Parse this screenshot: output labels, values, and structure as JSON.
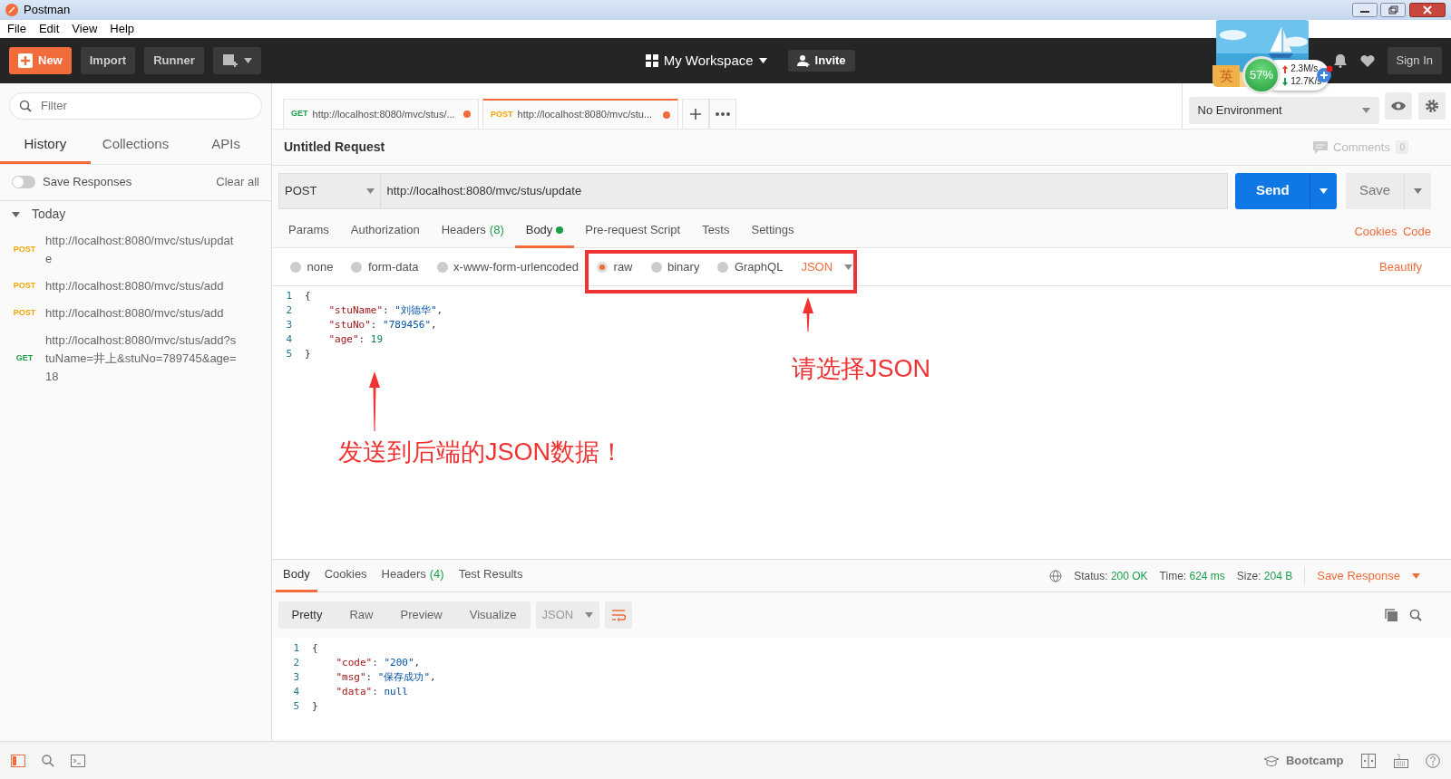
{
  "window": {
    "title": "Postman"
  },
  "menu": [
    "File",
    "Edit",
    "View",
    "Help"
  ],
  "header": {
    "new": "New",
    "buttons": [
      "Import",
      "Runner"
    ],
    "workspace": "My Workspace",
    "invite": "Invite",
    "sign_in": "Sign In"
  },
  "speed_widget": {
    "badge": "英",
    "percent": "57%",
    "upload": "2.3M/s",
    "download": "12.7K/s"
  },
  "sidebar": {
    "filter_placeholder": "Filter",
    "tabs": [
      {
        "label": "History",
        "selected": true
      },
      {
        "label": "Collections",
        "selected": false
      },
      {
        "label": "APIs",
        "selected": false
      }
    ],
    "save_responses": {
      "label": "Save Responses",
      "on": false
    },
    "clear_all": "Clear all",
    "group": {
      "label": "Today",
      "expanded": true,
      "items": [
        {
          "method": "POST",
          "color": "#f4a400",
          "url": "http://localhost:8080/mvc/stus/update"
        },
        {
          "method": "POST",
          "color": "#f4a400",
          "url": "http://localhost:8080/mvc/stus/add"
        },
        {
          "method": "POST",
          "color": "#f4a400",
          "url": "http://localhost:8080/mvc/stus/add"
        },
        {
          "method": "GET",
          "color": "#1c9e4a",
          "url": "http://localhost:8080/mvc/stus/add?stuName=井上&stuNo=789745&age=18"
        }
      ]
    }
  },
  "request_tabs": [
    {
      "method": "GET",
      "color": "#1c9e4a",
      "url": "http://localhost:8080/mvc/stus/...",
      "selected": false,
      "unsaved": true
    },
    {
      "method": "POST",
      "color": "#f4a400",
      "url": "http://localhost:8080/mvc/stu...",
      "selected": true,
      "unsaved": true
    }
  ],
  "environment": "No Environment",
  "request": {
    "title": "Untitled Request",
    "comments": "Comments",
    "comments_count": "0",
    "method": "POST",
    "url": "http://localhost:8080/mvc/stus/update",
    "send": "Send",
    "save": "Save"
  },
  "request_sections": [
    {
      "label": "Params",
      "selected": false
    },
    {
      "label": "Authorization",
      "selected": false
    },
    {
      "label": "Headers",
      "count": "(8)",
      "selected": false
    },
    {
      "label": "Body",
      "selected": true,
      "dot": true
    },
    {
      "label": "Pre-request Script",
      "selected": false
    },
    {
      "label": "Tests",
      "selected": false
    },
    {
      "label": "Settings",
      "selected": false
    }
  ],
  "request_links": [
    "Cookies",
    "Code"
  ],
  "body_types": [
    {
      "label": "none",
      "selected": false
    },
    {
      "label": "form-data",
      "selected": false
    },
    {
      "label": "x-www-form-urlencoded",
      "selected": false
    },
    {
      "label": "raw",
      "selected": true
    },
    {
      "label": "binary",
      "selected": false
    },
    {
      "label": "GraphQL",
      "selected": false
    }
  ],
  "body_format": "JSON",
  "beautify": "Beautify",
  "request_body": [
    {
      "number": "1",
      "tokens": [
        {
          "kind": "punct",
          "text": "{"
        }
      ]
    },
    {
      "number": "2",
      "tokens": [
        {
          "kind": "key",
          "text": "\"stuName\""
        },
        {
          "kind": "punct",
          "text": ": "
        },
        {
          "kind": "string",
          "text": "\"刘德华\""
        },
        {
          "kind": "punct",
          "text": ","
        }
      ]
    },
    {
      "number": "3",
      "tokens": [
        {
          "kind": "key",
          "text": "\"stuNo\""
        },
        {
          "kind": "punct",
          "text": ": "
        },
        {
          "kind": "string",
          "text": "\"789456\""
        },
        {
          "kind": "punct",
          "text": ","
        }
      ]
    },
    {
      "number": "4",
      "tokens": [
        {
          "kind": "key",
          "text": "\"age\""
        },
        {
          "kind": "punct",
          "text": ": "
        },
        {
          "kind": "number",
          "text": "19"
        }
      ]
    },
    {
      "number": "5",
      "tokens": [
        {
          "kind": "punct",
          "text": "}"
        }
      ]
    }
  ],
  "annotations": [
    {
      "text": "请选择JSON"
    },
    {
      "text": "发送到后端的JSON数据！"
    }
  ],
  "response": {
    "tabs": [
      {
        "label": "Body",
        "selected": true
      },
      {
        "label": "Cookies",
        "selected": false
      },
      {
        "label": "Headers",
        "count": "(4)",
        "selected": false
      },
      {
        "label": "Test Results",
        "selected": false
      }
    ],
    "stats": [
      {
        "label": "Status:",
        "value": "200 OK"
      },
      {
        "label": "Time:",
        "value": "624 ms"
      },
      {
        "label": "Size:",
        "value": "204 B"
      }
    ],
    "save_response": "Save Response",
    "view_modes": [
      {
        "label": "Pretty",
        "selected": true
      },
      {
        "label": "Raw",
        "selected": false
      },
      {
        "label": "Preview",
        "selected": false
      },
      {
        "label": "Visualize",
        "selected": false
      }
    ],
    "format": "JSON",
    "lines": [
      {
        "number": "1",
        "tokens": [
          {
            "kind": "punct",
            "text": "{"
          }
        ]
      },
      {
        "number": "2",
        "tokens": [
          {
            "kind": "key",
            "text": "\"code\""
          },
          {
            "kind": "punct",
            "text": ": "
          },
          {
            "kind": "string",
            "text": "\"200\""
          },
          {
            "kind": "punct",
            "text": ","
          }
        ]
      },
      {
        "number": "3",
        "tokens": [
          {
            "kind": "key",
            "text": "\"msg\""
          },
          {
            "kind": "punct",
            "text": ": "
          },
          {
            "kind": "string",
            "text": "\"保存成功\""
          },
          {
            "kind": "punct",
            "text": ","
          }
        ]
      },
      {
        "number": "4",
        "tokens": [
          {
            "kind": "key",
            "text": "\"data\""
          },
          {
            "kind": "punct",
            "text": ": "
          },
          {
            "kind": "null",
            "text": "null"
          }
        ]
      },
      {
        "number": "5",
        "tokens": [
          {
            "kind": "punct",
            "text": "}"
          }
        ]
      }
    ]
  },
  "footer": {
    "bootcamp": "Bootcamp"
  }
}
